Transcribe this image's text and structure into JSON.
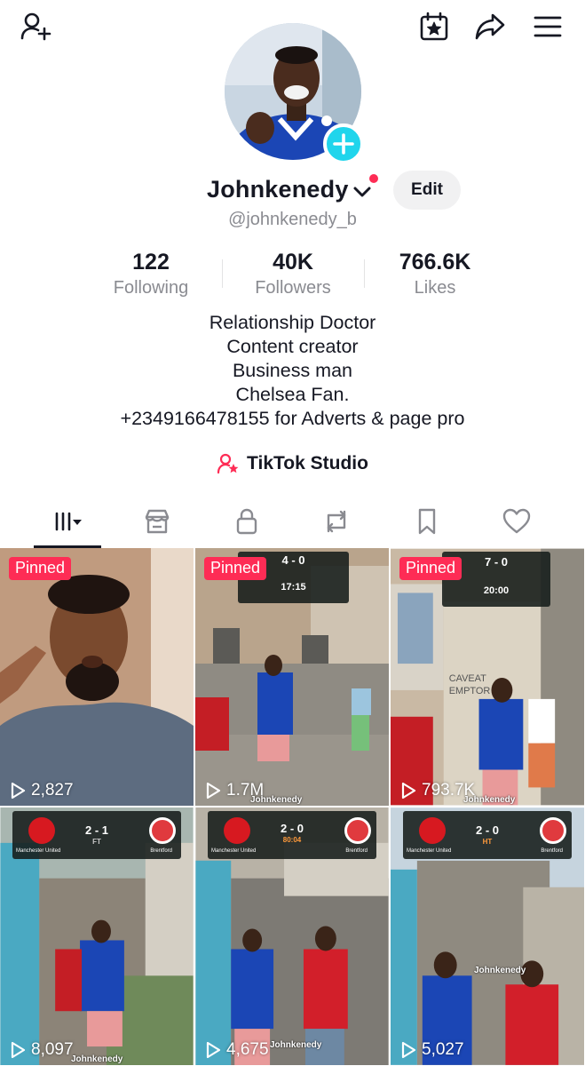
{
  "topbar": {
    "left_icon": "add-friend-icon",
    "right_icons": [
      "calendar-star-icon",
      "share-arrow-icon",
      "hamburger-menu-icon"
    ]
  },
  "profile": {
    "display_name": "Johnkenedy",
    "username": "@johnkenedy_b",
    "edit_label": "Edit",
    "add_badge_icon": "plus-icon"
  },
  "stats": [
    {
      "value": "122",
      "label": "Following"
    },
    {
      "value": "40K",
      "label": "Followers"
    },
    {
      "value": "766.6K",
      "label": "Likes"
    }
  ],
  "bio": [
    "Relationship Doctor",
    "Content creator",
    "Business man",
    "Chelsea Fan.",
    "+2349166478155 for Adverts & page pro"
  ],
  "studio": {
    "label": "TikTok Studio",
    "icon": "person-star-icon"
  },
  "tabs": [
    {
      "name": "videos",
      "icon": "grid-lines-icon",
      "active": true
    },
    {
      "name": "shop",
      "icon": "shop-icon",
      "active": false
    },
    {
      "name": "private",
      "icon": "lock-icon",
      "active": false
    },
    {
      "name": "reposts",
      "icon": "repost-icon",
      "active": false
    },
    {
      "name": "favorites",
      "icon": "bookmark-icon",
      "active": false
    },
    {
      "name": "liked",
      "icon": "heart-icon",
      "active": false
    }
  ],
  "videos": [
    {
      "pinned": "Pinned",
      "views": "2,827",
      "watermark": ""
    },
    {
      "pinned": "Pinned",
      "views": "1.7M",
      "watermark": "Johnkenedy",
      "scoreboard": {
        "score": "4 - 0",
        "time": "17:15"
      }
    },
    {
      "pinned": "Pinned",
      "views": "793.7K",
      "watermark": "Johnkenedy",
      "scoreboard": {
        "score": "7 - 0",
        "time": "20:00"
      }
    },
    {
      "pinned": "",
      "views": "8,097",
      "watermark": "Johnkenedy",
      "scoreboard": {
        "score": "2 - 1",
        "home": "Manchester United",
        "away": "Brentford",
        "sub": "FT"
      }
    },
    {
      "pinned": "",
      "views": "4,675",
      "watermark": "Johnkenedy",
      "scoreboard": {
        "score": "2 - 0",
        "home": "Manchester United",
        "away": "Brentford",
        "sub": "80:04"
      }
    },
    {
      "pinned": "",
      "views": "5,027",
      "watermark": "Johnkenedy",
      "scoreboard": {
        "score": "2 - 0",
        "home": "Manchester United",
        "away": "Brentford",
        "sub": "HT"
      }
    }
  ],
  "colors": {
    "accent": "#fe2c55",
    "badge": "#20d5ec",
    "text": "#161823",
    "muted": "#8a8b91"
  }
}
